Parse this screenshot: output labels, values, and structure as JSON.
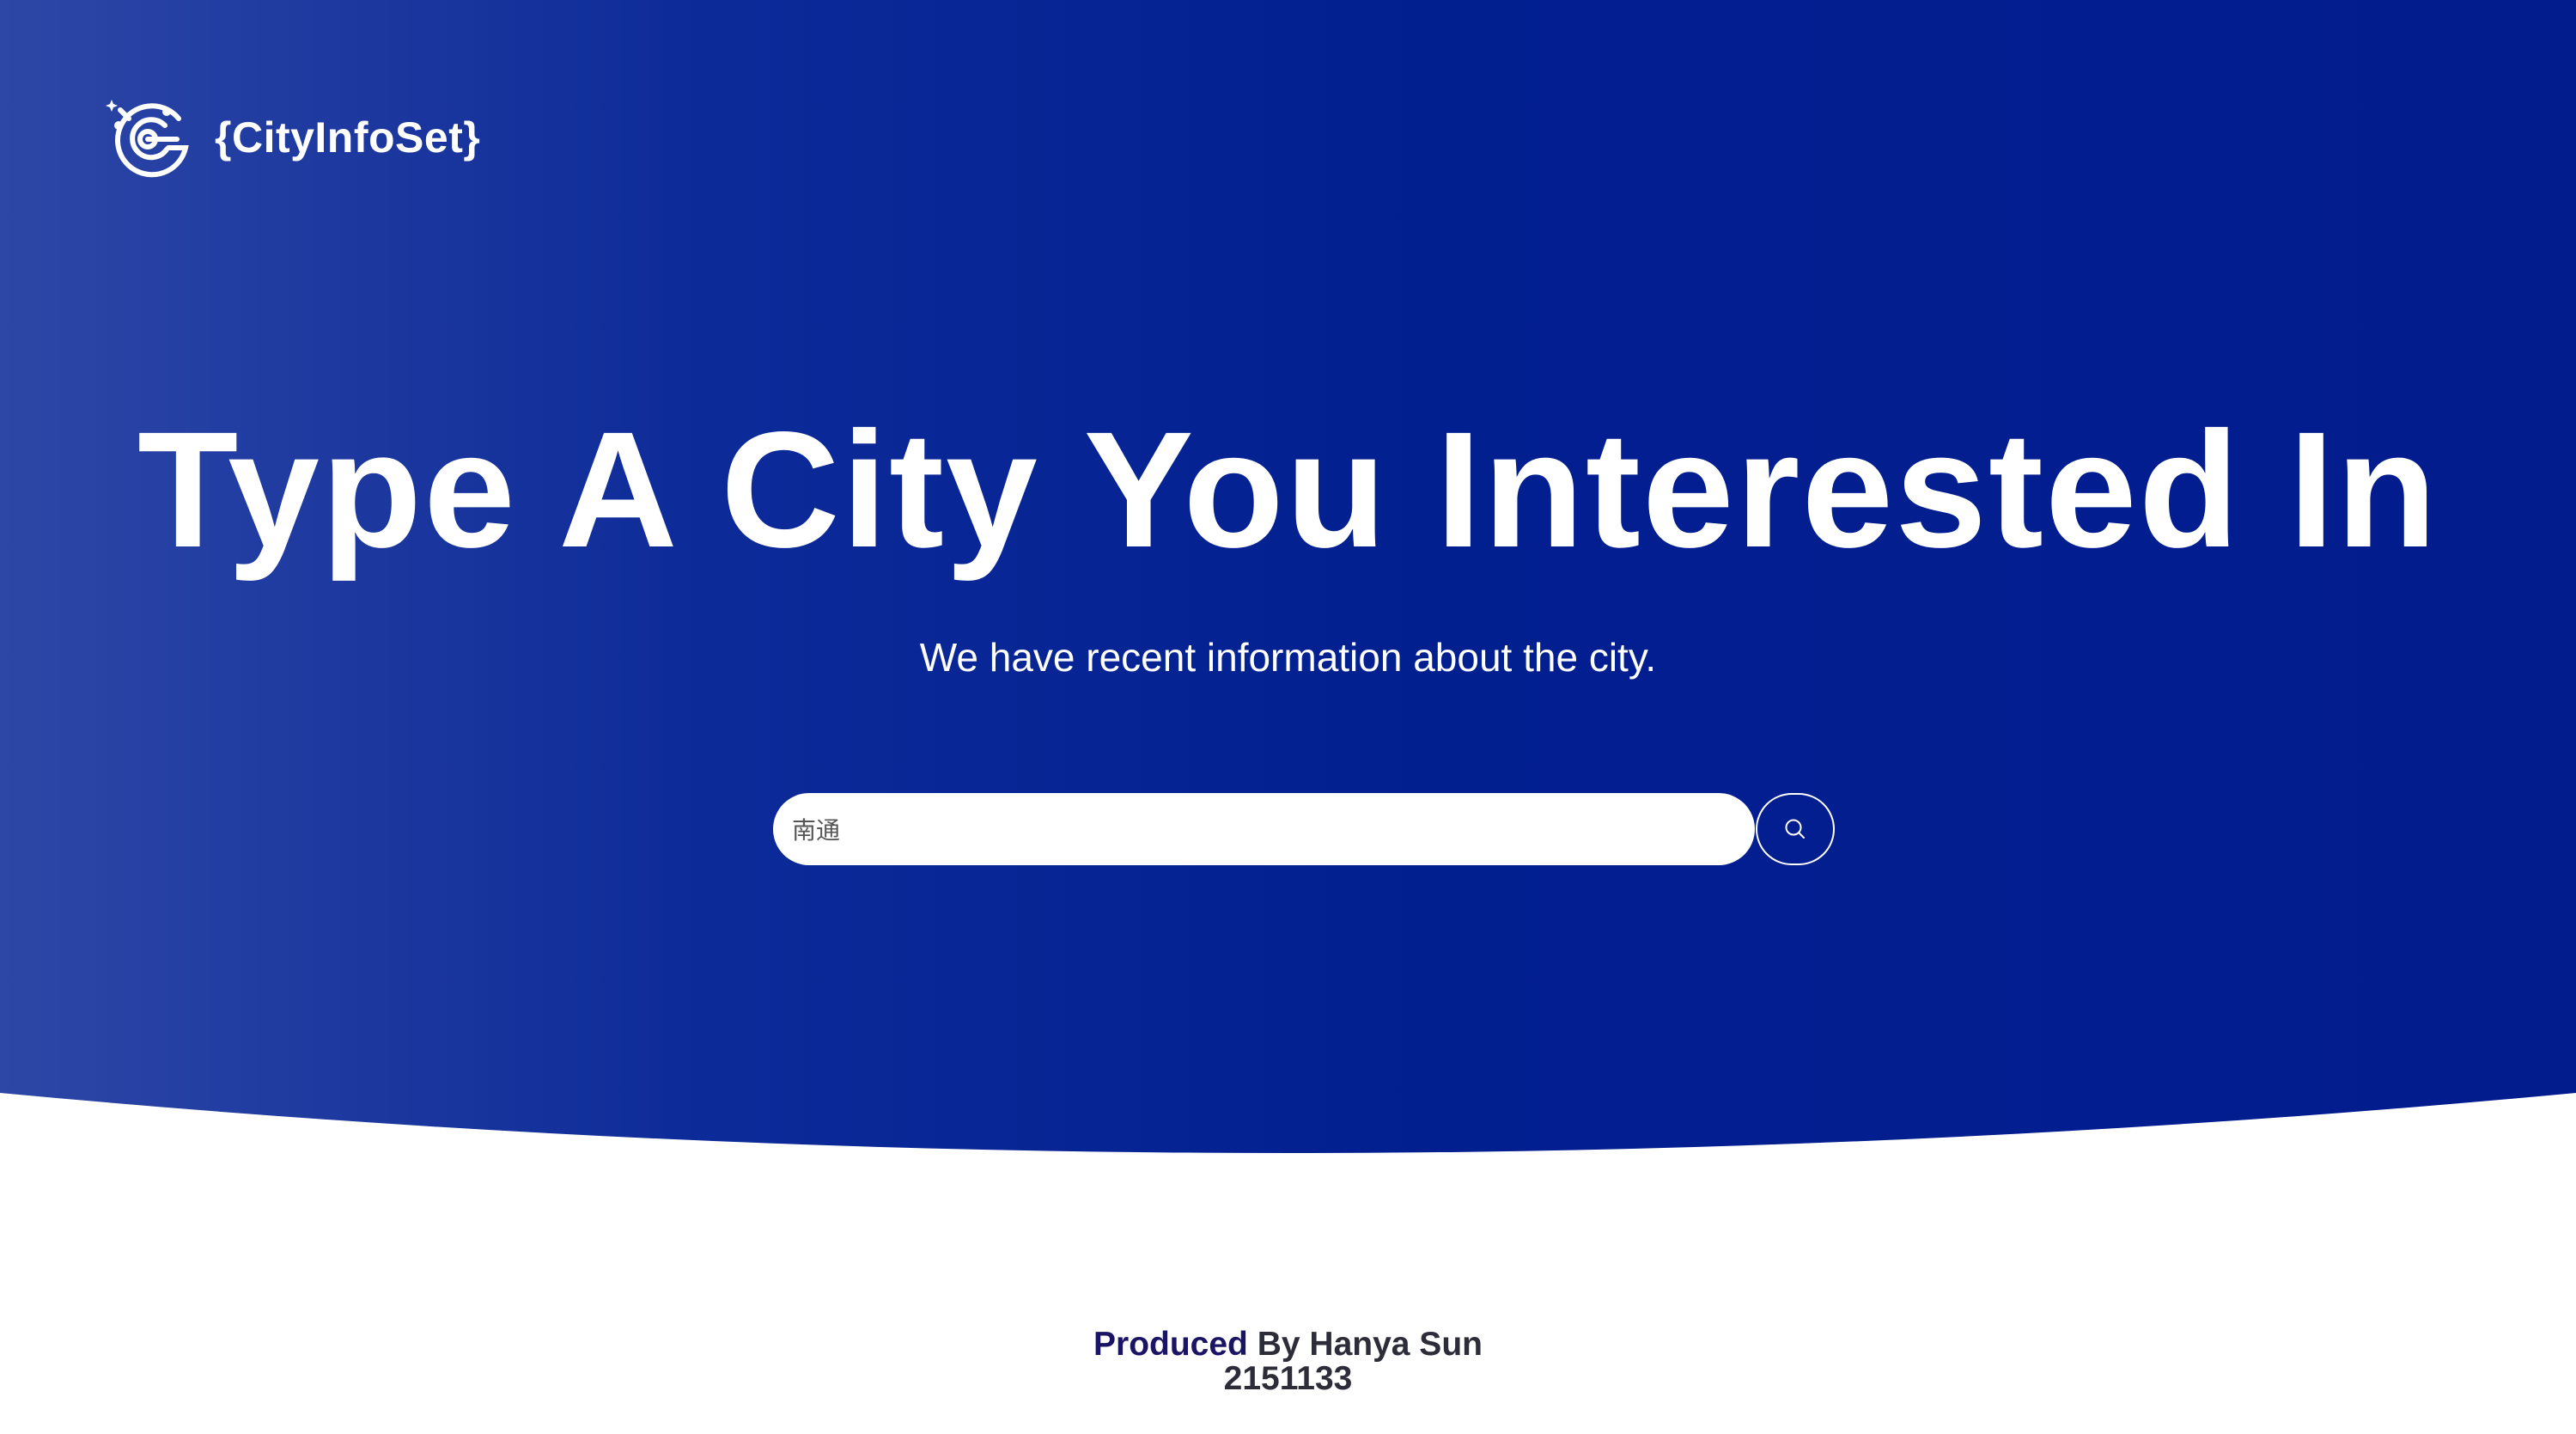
{
  "brand": {
    "name": "{CityInfoSet}",
    "logo_icon": "cityinfoset-logo-icon"
  },
  "hero": {
    "headline": "Type A City You Interested In",
    "subheadline": "We have recent information about the city."
  },
  "search": {
    "value": "南通",
    "placeholder": "",
    "button_icon": "search-icon"
  },
  "footer": {
    "produced_label": "Produced",
    "by_text": " By Hanya Sun",
    "student_id": "2151133"
  },
  "colors": {
    "hero_gradient_left": "#2d47a6",
    "hero_gradient_right": "#021e8f",
    "accent_dark": "#1b1464",
    "page_background": "#ffffff"
  }
}
